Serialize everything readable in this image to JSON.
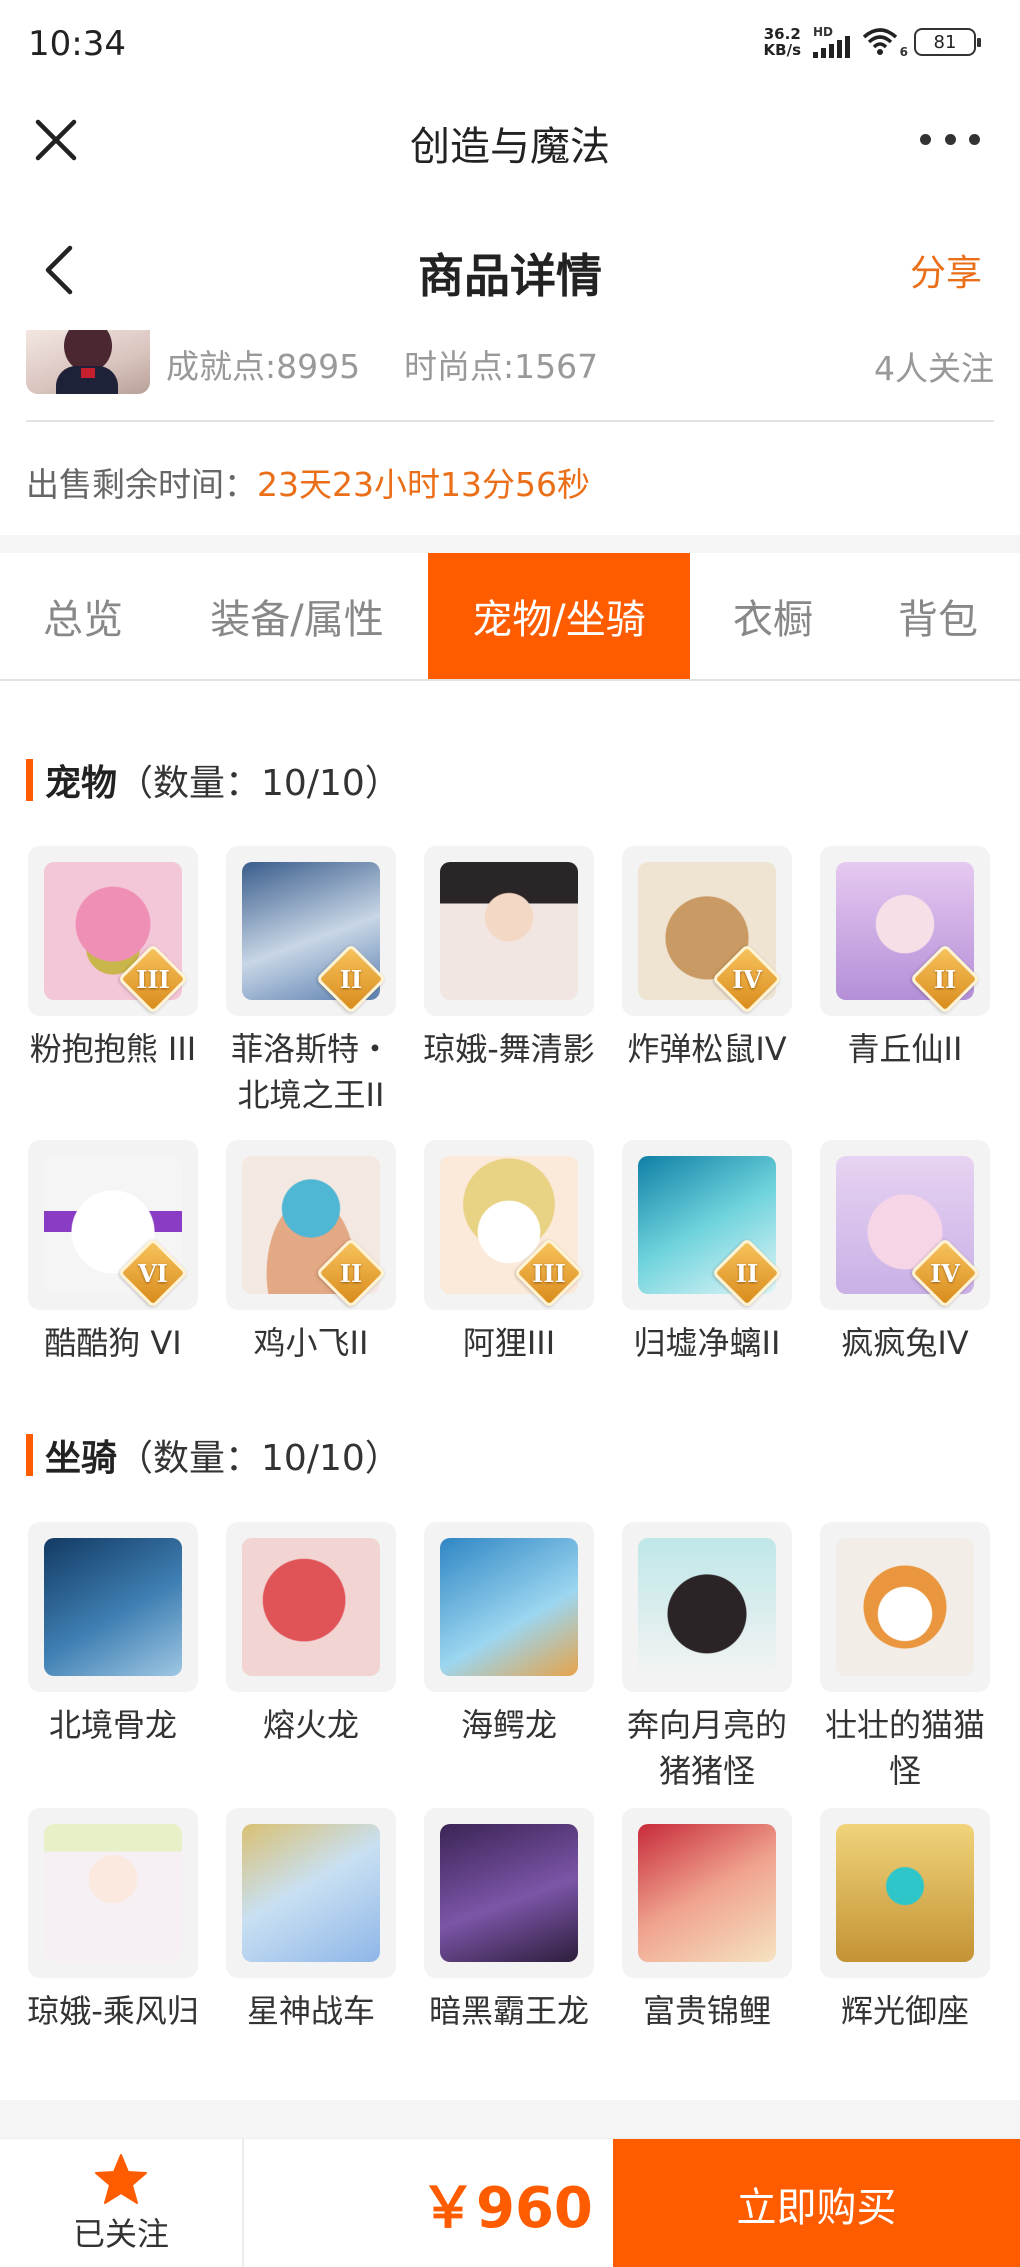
{
  "status_bar": {
    "time": "10:34",
    "net_speed_value": "36.2",
    "net_speed_unit": "KB/s",
    "network": "HD",
    "wifi_label": "6",
    "battery": "81"
  },
  "app_header": {
    "title": "创造与魔法",
    "close_icon": "close-icon",
    "more_icon": "more-icon"
  },
  "page_header": {
    "title": "商品详情",
    "share": "分享",
    "back_icon": "back-icon"
  },
  "stats": {
    "achievement": "成就点:8995",
    "fashion": "时尚点:1567",
    "followers": "4人关注"
  },
  "sale": {
    "label": "出售剩余时间：",
    "value": "23天23小时13分56秒"
  },
  "tabs": [
    {
      "label": "总览",
      "active": false
    },
    {
      "label": "装备/属性",
      "active": false
    },
    {
      "label": "宠物/坐骑",
      "active": true
    },
    {
      "label": "衣橱",
      "active": false
    },
    {
      "label": "背包",
      "active": false
    }
  ],
  "pets": {
    "title": "宠物",
    "count": "（数量：10/10）",
    "items": [
      {
        "name": "粉抱抱熊 III",
        "grade": "III"
      },
      {
        "name": "菲洛斯特・北境之王II",
        "grade": "II"
      },
      {
        "name": "琼娥-舞清影",
        "grade": ""
      },
      {
        "name": "炸弹松鼠IV",
        "grade": "IV"
      },
      {
        "name": "青丘仙II",
        "grade": "II"
      },
      {
        "name": "酷酷狗 VI",
        "grade": "VI"
      },
      {
        "name": "鸡小飞II",
        "grade": "II"
      },
      {
        "name": "阿狸III",
        "grade": "III"
      },
      {
        "name": "归墟净螭II",
        "grade": "II"
      },
      {
        "name": "疯疯兔IV",
        "grade": "IV"
      }
    ]
  },
  "mounts": {
    "title": "坐骑",
    "count": "（数量：10/10）",
    "items": [
      {
        "name": "北境骨龙"
      },
      {
        "name": "熔火龙"
      },
      {
        "name": "海鳄龙"
      },
      {
        "name": "奔向月亮的猪猪怪"
      },
      {
        "name": "壮壮的猫猫怪"
      },
      {
        "name": "琼娥-乘风归"
      },
      {
        "name": "星神战车"
      },
      {
        "name": "暗黑霸王龙"
      },
      {
        "name": "富贵锦鲤"
      },
      {
        "name": "辉光御座"
      }
    ]
  },
  "bottom_bar": {
    "follow_label": "已关注",
    "price": "￥960",
    "buy_label": "立即购买"
  },
  "colors": {
    "accent": "#ff5c00",
    "accent_text": "#ea6f18"
  }
}
